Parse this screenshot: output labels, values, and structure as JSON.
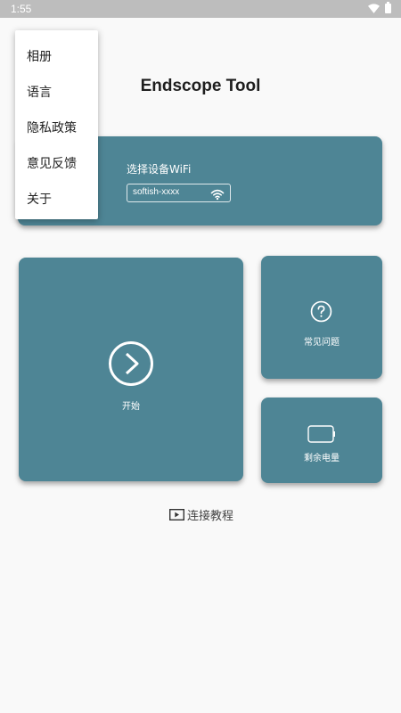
{
  "status_bar": {
    "time": "1:55"
  },
  "app": {
    "title": "Endscope Tool"
  },
  "wifi_card": {
    "label": "选择设备WiFi",
    "ssid": "softish-xxxx"
  },
  "start_card": {
    "label": "开始"
  },
  "faq_card": {
    "label": "常见问题"
  },
  "battery_card": {
    "label": "剩余电量"
  },
  "tutorial": {
    "label": "连接教程"
  },
  "menu": {
    "items": [
      {
        "label": "相册"
      },
      {
        "label": "语言"
      },
      {
        "label": "隐私政策"
      },
      {
        "label": "意见反馈"
      },
      {
        "label": "关于"
      }
    ]
  },
  "colors": {
    "card": "#4e8595",
    "status_bar": "#bdbdbd",
    "background": "#f9f9f9"
  },
  "icons": [
    "wifi-icon",
    "battery-icon",
    "play-circle-icon",
    "help-circle-icon",
    "battery-outline-icon",
    "video-play-icon"
  ]
}
